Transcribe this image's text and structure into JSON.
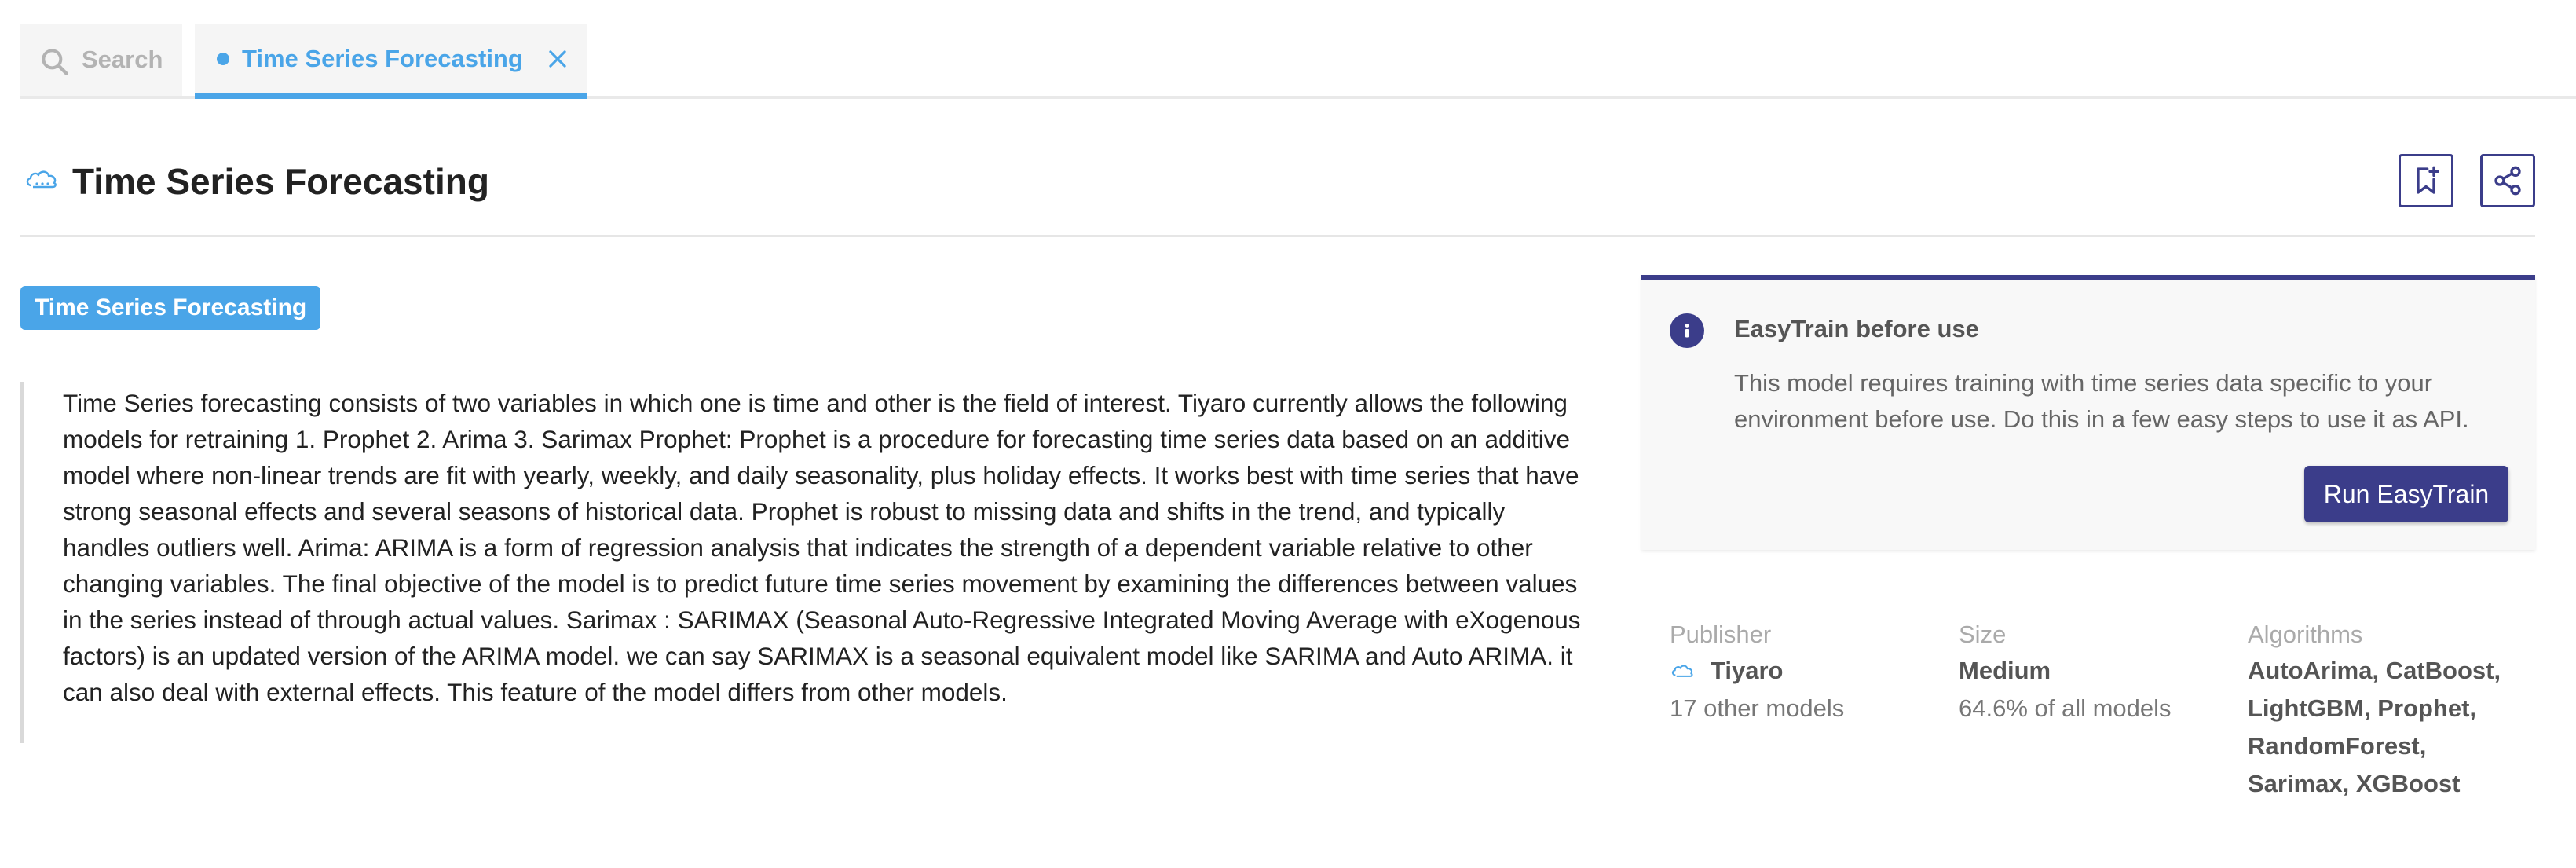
{
  "tabs": {
    "search_label": "Search",
    "active_label": "Time Series Forecasting"
  },
  "header": {
    "title": "Time Series Forecasting",
    "icons": [
      "cloud-icon",
      "bookmark-add-icon",
      "share-icon"
    ]
  },
  "tag": "Time Series Forecasting",
  "description": "Time Series forecasting consists of two variables in which one is time and other is the field of interest. Tiyaro currently allows the following models for retraining 1. Prophet 2. Arima 3. Sarimax Prophet: Prophet is a procedure for forecasting time series data based on an additive model where non-linear trends are fit with yearly, weekly, and daily seasonality, plus holiday effects. It works best with time series that have strong seasonal effects and several seasons of historical data. Prophet is robust to missing data and shifts in the trend, and typically handles outliers well. Arima: ARIMA is a form of regression analysis that indicates the strength of a dependent variable relative to other changing variables. The final objective of the model is to predict future time series movement by examining the differences between values in the series instead of through actual values. Sarimax : SARIMAX (Seasonal Auto-Regressive Integrated Moving Average with eXogenous factors) is an updated version of the ARIMA model. we can say SARIMAX is a seasonal equivalent model like SARIMA and Auto ARIMA. it can also deal with external effects. This feature of the model differs from other models.",
  "callout": {
    "title": "EasyTrain before use",
    "text": "This model requires training with time series data specific to your environment before use. Do this in a few easy steps to use it as API.",
    "button_label": "Run EasyTrain"
  },
  "meta": {
    "publisher": {
      "label": "Publisher",
      "name": "Tiyaro",
      "sub": "17 other models"
    },
    "size": {
      "label": "Size",
      "value": "Medium",
      "sub": "64.6% of all models"
    },
    "algorithms": {
      "label": "Algorithms",
      "value": "AutoArima, CatBoost, LightGBM, Prophet, RandomForest, Sarimax, XGBoost"
    }
  },
  "colors": {
    "accent_blue": "#4aa5e8",
    "primary_indigo": "#3b3d8a"
  }
}
